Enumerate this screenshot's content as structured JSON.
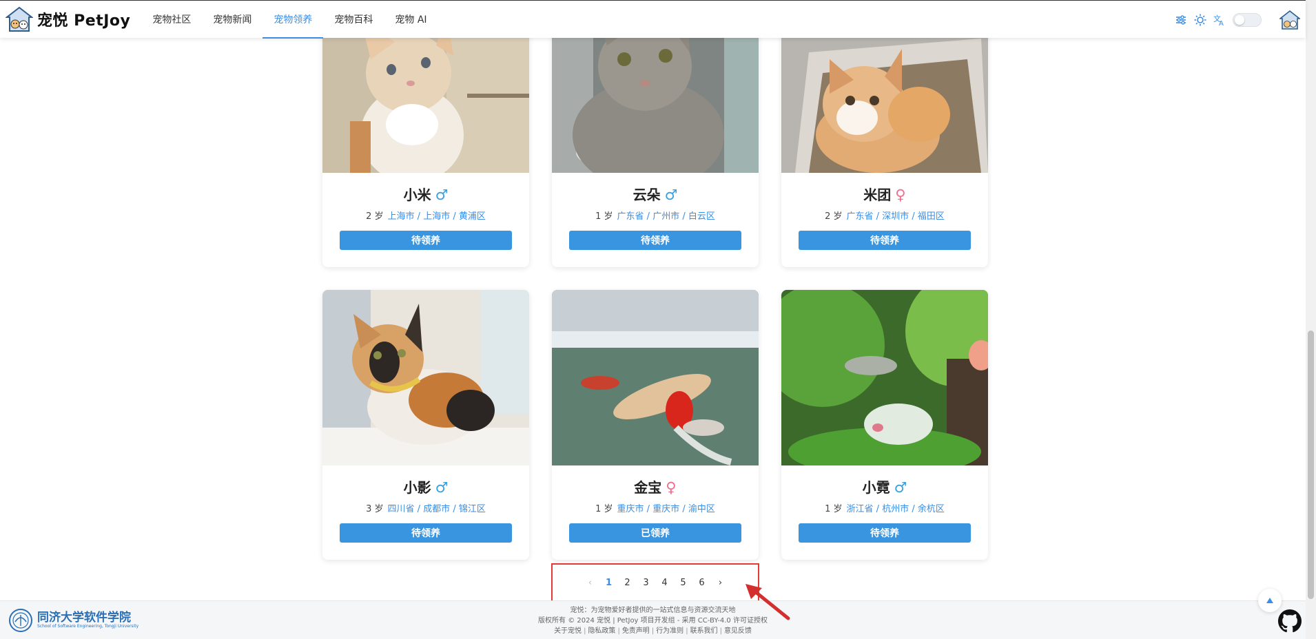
{
  "header": {
    "brand": "宠悦 PetJoy",
    "nav": [
      {
        "label": "宠物社区",
        "active": false
      },
      {
        "label": "宠物新闻",
        "active": false
      },
      {
        "label": "宠物领养",
        "active": true
      },
      {
        "label": "宠物百科",
        "active": false
      },
      {
        "label": "宠物 AI",
        "active": false
      }
    ],
    "tools": [
      "settings-sliders-icon",
      "sun-icon",
      "translate-icon",
      "theme-toggle",
      "avatar"
    ]
  },
  "pets": [
    {
      "name": "小米",
      "gender": "♂",
      "gender_type": "male",
      "age": "2 岁",
      "location": "上海市 / 上海市 / 黄浦区",
      "status": "待领养"
    },
    {
      "name": "云朵",
      "gender": "♂",
      "gender_type": "male",
      "age": "1 岁",
      "location": "广东省 / 广州市 / 白云区",
      "status": "待领养"
    },
    {
      "name": "米团",
      "gender": "♀",
      "gender_type": "female",
      "age": "2 岁",
      "location": "广东省 / 深圳市 / 福田区",
      "status": "待领养"
    },
    {
      "name": "小影",
      "gender": "♂",
      "gender_type": "male",
      "age": "3 岁",
      "location": "四川省 / 成都市 / 锦江区",
      "status": "待领养"
    },
    {
      "name": "金宝",
      "gender": "♀",
      "gender_type": "female",
      "age": "1 岁",
      "location": "重庆市 / 重庆市 / 渝中区",
      "status": "已领养"
    },
    {
      "name": "小霓",
      "gender": "♂",
      "gender_type": "male",
      "age": "1 岁",
      "location": "浙江省 / 杭州市 / 余杭区",
      "status": "待领养"
    }
  ],
  "pagination": {
    "prev": "‹",
    "pages": [
      "1",
      "2",
      "3",
      "4",
      "5",
      "6"
    ],
    "current": 1,
    "next": "›"
  },
  "footer": {
    "school_name": "同济大学软件学院",
    "school_sub": "School of Software Engineering, Tongji University",
    "tagline": "宠悦：为宠物爱好者提供的一站式信息与资源交流天地",
    "copyright": "版权所有 © 2024 宠悦 | PetJoy 项目开发组 - 采用 CC-BY-4.0 许可证授权",
    "links": [
      "关于宠悦",
      "隐私政策",
      "免责声明",
      "行为准则",
      "联系我们",
      "意见反馈"
    ]
  },
  "colors": {
    "accent": "#3a8ee6",
    "button": "#3a95e0",
    "male": "#3ba0e0",
    "female": "#f06d8c",
    "highlight": "#e53935"
  }
}
